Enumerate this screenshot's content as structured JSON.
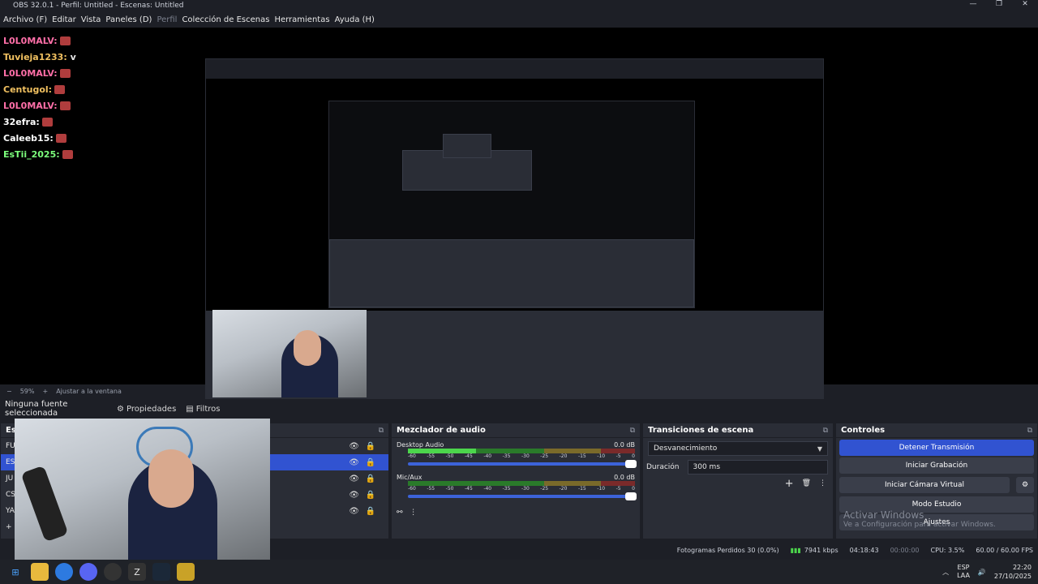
{
  "window": {
    "title": "OBS 32.0.1 - Perfil: Untitled - Escenas: Untitled"
  },
  "menu": [
    "Archivo (F)",
    "Editar",
    "Vista",
    "Paneles (D)",
    "Perfil",
    "Colección de Escenas",
    "Herramientas",
    "Ayuda (H)"
  ],
  "chat": [
    {
      "user": "L0L0MALV:",
      "color": "#ff6fa8"
    },
    {
      "user": "Tuvieja1233:",
      "color": "#f0c060",
      "msg": "v"
    },
    {
      "user": "L0L0MALV:",
      "color": "#ff6fa8"
    },
    {
      "user": "Centugol:",
      "color": "#f0c060"
    },
    {
      "user": "L0L0MALV:",
      "color": "#ff6fa8"
    },
    {
      "user": "32efra:",
      "color": "#ffffff"
    },
    {
      "user": "Caleeb15:",
      "color": "#ffffff"
    },
    {
      "user": "EsTii_2025:",
      "color": "#7cff7c"
    }
  ],
  "zoom": {
    "minus": "−",
    "level": "59%",
    "plus": "+",
    "fit": "Ajustar a la ventana"
  },
  "source_bar": {
    "none": "Ninguna fuente seleccionada",
    "properties": "Propiedades",
    "filters": "Filtros"
  },
  "docks": {
    "sources": {
      "title": "Escenas",
      "rows": [
        "FU",
        "ES",
        "JU",
        "CS",
        "YA"
      ]
    },
    "mixer": {
      "title": "Mezclador de audio",
      "channels": [
        {
          "name": "Desktop Audio",
          "db": "0.0 dB",
          "level": 0.3
        },
        {
          "name": "Mic/Aux",
          "db": "0.0 dB",
          "level": 0.0
        }
      ],
      "scale": [
        "-60",
        "-55",
        "-50",
        "-45",
        "-40",
        "-35",
        "-30",
        "-25",
        "-20",
        "-15",
        "-10",
        "-5",
        "0"
      ]
    },
    "transitions": {
      "title": "Transiciones de escena",
      "selected": "Desvanecimiento",
      "duration_label": "Duración",
      "duration_value": "300 ms"
    },
    "controls": {
      "title": "Controles",
      "buttons": [
        "Detener Transmisión",
        "Iniciar Grabación",
        "Iniciar Cámara Virtual",
        "Modo Estudio",
        "Ajustes"
      ]
    }
  },
  "activate": {
    "line1": "Activar Windows",
    "line2": "Ve a Configuración para activar Windows."
  },
  "status": {
    "dropped": "Fotogramas Perdidos 30 (0.0%)",
    "kbps": "7941 kbps",
    "live": "04:18:43",
    "rec": "00:00:00",
    "cpu": "CPU: 3.5%",
    "fps": "60.00 / 60.00 FPS"
  },
  "tray": {
    "lang1": "ESP",
    "lang2": "LAA",
    "time": "22:20",
    "date": "27/10/2025"
  },
  "colors": {
    "accent": "#3153d1",
    "panel": "#2a2d36",
    "bg": "#1d1f26"
  }
}
